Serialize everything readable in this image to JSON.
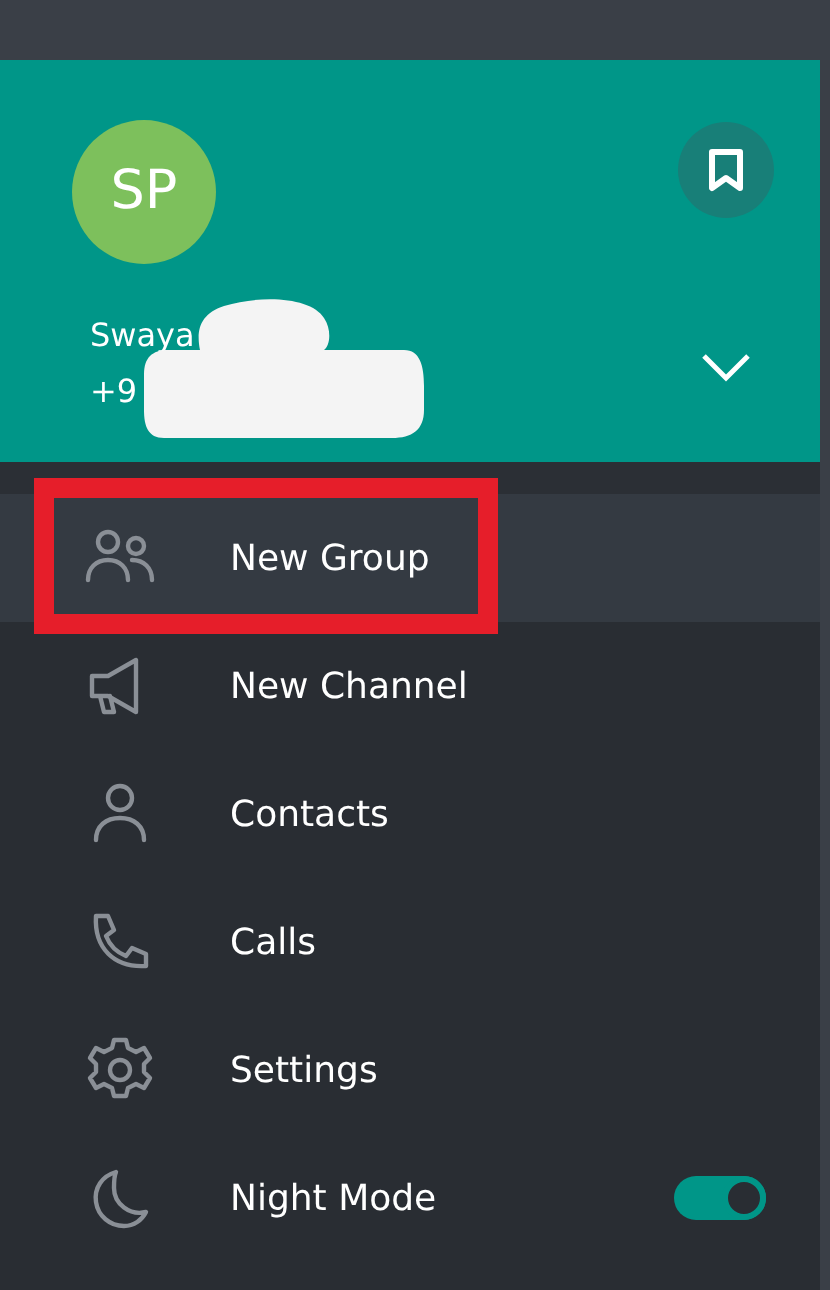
{
  "profile": {
    "initials": "SP",
    "name": "Swaya",
    "phone": "+9"
  },
  "menu": [
    {
      "kind": "group",
      "label": "New Group",
      "selected": true
    },
    {
      "kind": "channel",
      "label": "New Channel",
      "selected": false
    },
    {
      "kind": "contacts",
      "label": "Contacts",
      "selected": false
    },
    {
      "kind": "calls",
      "label": "Calls",
      "selected": false
    },
    {
      "kind": "settings",
      "label": "Settings",
      "selected": false
    },
    {
      "kind": "night",
      "label": "Night Mode",
      "selected": false,
      "on": true
    }
  ]
}
